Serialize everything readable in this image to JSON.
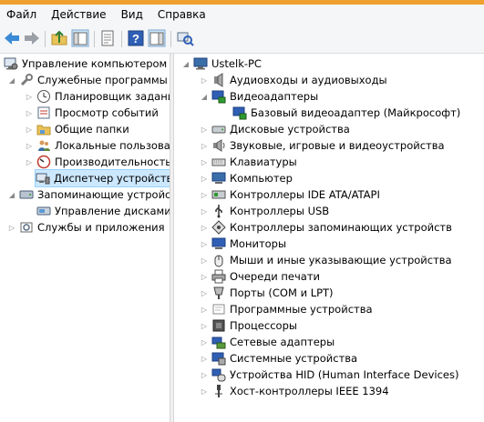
{
  "menu": [
    "Файл",
    "Действие",
    "Вид",
    "Справка"
  ],
  "toolbar": [
    "back-icon",
    "forward-icon",
    "up-folder-icon",
    "show-hide-tree-icon",
    "properties-icon",
    "help-icon",
    "action-pane-icon",
    "scan-hardware-icon"
  ],
  "tree_left": {
    "root": "Управление компьютером (л",
    "system_tools": "Служебные программы",
    "task_scheduler": "Планировщик заданий",
    "event_viewer": "Просмотр событий",
    "shared_folders": "Общие папки",
    "local_users": "Локальные пользовате",
    "performance": "Производительность",
    "device_manager": "Диспетчер устройств",
    "storage": "Запоминающие устройст",
    "disk_management": "Управление дисками",
    "services": "Службы и приложения"
  },
  "tree_right": {
    "root": "Ustelk-PC",
    "items": [
      "Аудиовходы и аудиовыходы",
      "Видеоадаптеры",
      "Базовый видеоадаптер (Майкрософт)",
      "Дисковые устройства",
      "Звуковые, игровые и видеоустройства",
      "Клавиатуры",
      "Компьютер",
      "Контроллеры IDE ATA/ATAPI",
      "Контроллеры USB",
      "Контроллеры запоминающих устройств",
      "Мониторы",
      "Мыши и иные указывающие устройства",
      "Очереди печати",
      "Порты (COM и LPT)",
      "Программные устройства",
      "Процессоры",
      "Сетевые адаптеры",
      "Системные устройства",
      "Устройства HID (Human Interface Devices)",
      "Хост-контроллеры IEEE 1394"
    ]
  }
}
